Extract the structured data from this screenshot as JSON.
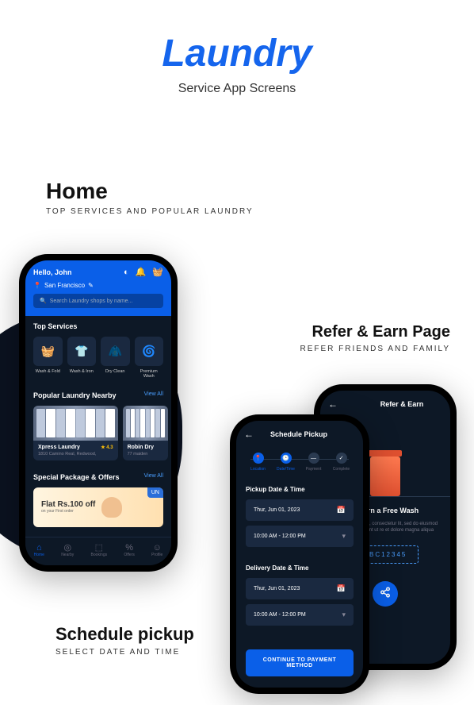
{
  "page": {
    "title": "Laundry",
    "subtitle": "Service App Screens"
  },
  "labels": {
    "home": {
      "h": "Home",
      "p": "TOP SERVICES AND POPULAR LAUNDRY"
    },
    "refer": {
      "h": "Refer & Earn Page",
      "p": "REFER FRIENDS AND FAMILY"
    },
    "schedule": {
      "h": "Schedule pickup",
      "p": "SELECT DATE AND TIME"
    }
  },
  "home": {
    "greeting": "Hello, John",
    "location": "San Francisco",
    "search_placeholder": "Search Laundry shops by name...",
    "top_services_title": "Top Services",
    "services": [
      {
        "label": "Wash & Fold",
        "emoji": "🧺"
      },
      {
        "label": "Wash & Iron",
        "emoji": "👕"
      },
      {
        "label": "Dry Clean",
        "emoji": "🧥"
      },
      {
        "label": "Premium Wash",
        "emoji": "🌀"
      }
    ],
    "nearby_title": "Popular Laundry Nearby",
    "view_all": "View All",
    "nearby": [
      {
        "name": "Xpress Laundry",
        "rating": "★ 4.3",
        "addr": "1810 Camino Real, Redwood,"
      },
      {
        "name": "Robin Dry",
        "addr": "77 maiden"
      }
    ],
    "offers_title": "Special Package & Offers",
    "offer_text": "Flat Rs.100 off",
    "offer_sub": "on your First order",
    "offer_tag": "UN",
    "nav": [
      {
        "label": "Home",
        "icon": "⌂"
      },
      {
        "label": "Nearby",
        "icon": "◎"
      },
      {
        "label": "Bookings",
        "icon": "⬚"
      },
      {
        "label": "Offers",
        "icon": "%"
      },
      {
        "label": "Profile",
        "icon": "☺"
      }
    ]
  },
  "refer": {
    "toolbar_title": "Refer & Earn",
    "heading": "& Earn a Free Wash",
    "desc": "um dolor sit amet, consectetur lit, sed do eiusmod tempor incididunt ut re et dolore magna aliqua",
    "code": "ABC12345"
  },
  "schedule": {
    "toolbar_title": "Schedule Pickup",
    "steps": [
      {
        "label": "Location",
        "icon": "📍"
      },
      {
        "label": "Date/Time",
        "icon": "🕒"
      },
      {
        "label": "Payment",
        "icon": "—"
      },
      {
        "label": "Complete",
        "icon": "✓"
      }
    ],
    "pickup_title": "Pickup Date & Time",
    "delivery_title": "Delivery Date & Time",
    "date_value": "Thur, Jun 01, 2023",
    "time_value": "10:00 AM - 12:00 PM",
    "continue": "CONTINUE TO PAYMENT METHOD"
  }
}
